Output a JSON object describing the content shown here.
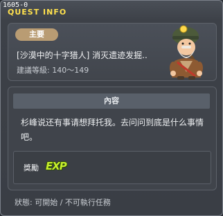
{
  "window": {
    "quest_id": "1605-0",
    "title": "QUEST INFO"
  },
  "quest": {
    "badge": "主要",
    "name": "[沙漠中的十字猎人] 消灭遗迹发掘..",
    "level": "建議等級: 140～149",
    "npc_icon": "miner-npc-portrait"
  },
  "content": {
    "header": "內容",
    "description": "杉峰说还有事请想拜托我。去问问到底是什么事情吧。"
  },
  "reward": {
    "label": "獎勵",
    "exp_label": "EXP"
  },
  "status": {
    "text": "狀態: 可開始 / 不可執行任務"
  },
  "colors": {
    "title": "#ffe14d",
    "badge": "#b99c73",
    "exp": "#c7ef2d"
  }
}
